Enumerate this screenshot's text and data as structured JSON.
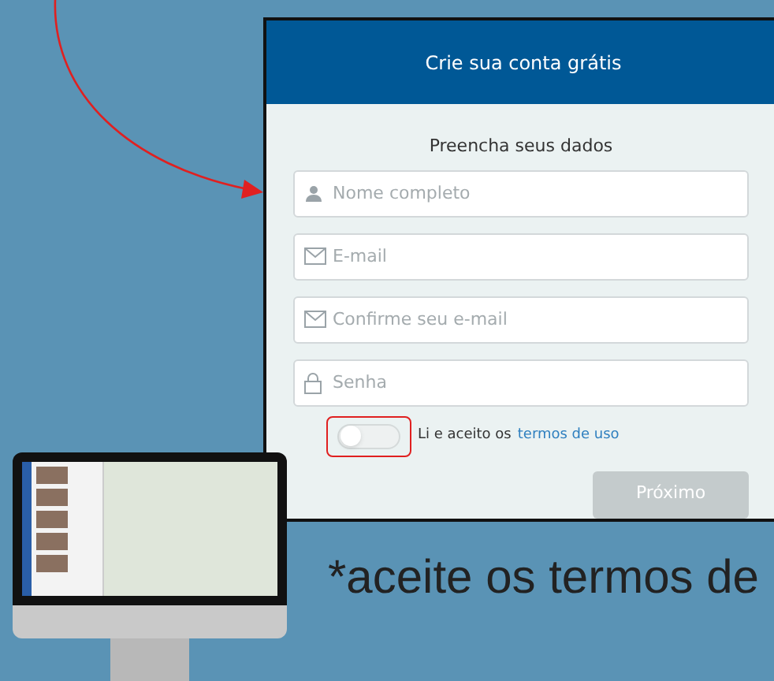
{
  "form": {
    "title": "Crie sua conta grátis",
    "subtitle": "Preencha seus dados",
    "fields": [
      {
        "kind": "person",
        "placeholder": "Nome completo"
      },
      {
        "kind": "mail",
        "placeholder": "E-mail"
      },
      {
        "kind": "mail",
        "placeholder": "Confirme seu e-mail"
      },
      {
        "kind": "lock",
        "placeholder": "Senha"
      }
    ],
    "terms": {
      "on": false,
      "text": "Li e aceito os",
      "link": "termos de uso"
    },
    "next_button": {
      "label": "Próximo",
      "disabled": true
    }
  },
  "caption": "*aceite os termos de"
}
